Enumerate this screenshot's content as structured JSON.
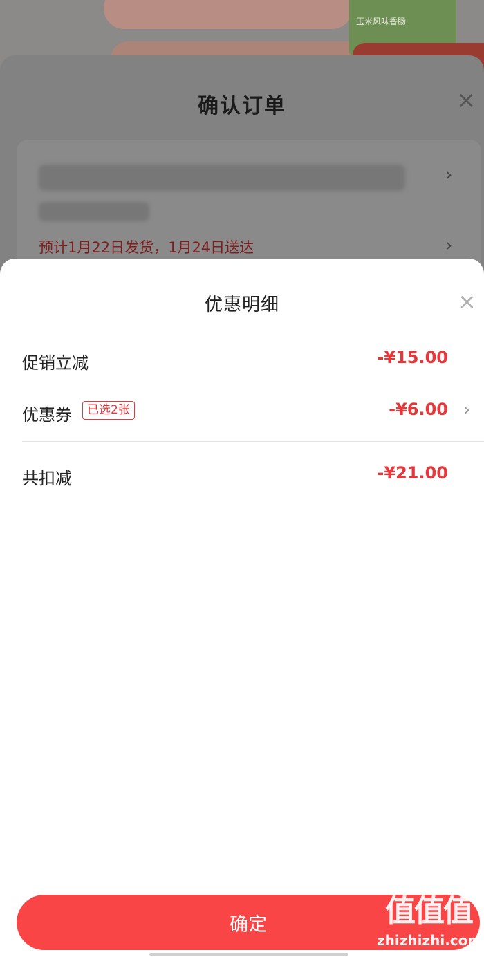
{
  "background": {
    "package_text": "玉米风味香肠",
    "order_title": "确认订单",
    "delivery_text": "预计1月22日发货，1月24日送达"
  },
  "sheet": {
    "title": "优惠明细",
    "rows": [
      {
        "label": "促销立减",
        "amount": "-¥15.00"
      },
      {
        "label": "优惠券",
        "badge": "已选2张",
        "amount": "-¥6.00"
      },
      {
        "label": "共扣减",
        "amount": "-¥21.00"
      }
    ],
    "confirm_label": "确定"
  },
  "watermark": {
    "glyphs": "值值值",
    "domain": "zhizhizhi.com"
  },
  "colors": {
    "accent": "#e8373a",
    "button": "#f94545"
  }
}
